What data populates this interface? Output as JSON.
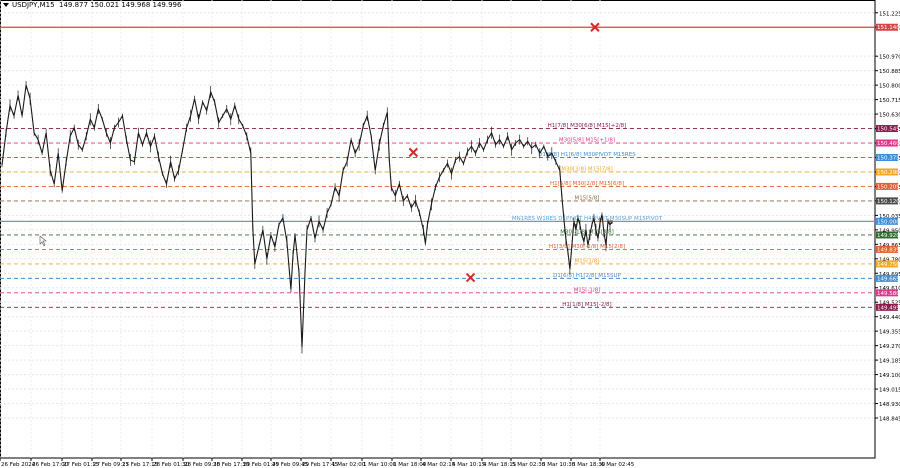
{
  "header": {
    "symbol": "USDJPY,M15",
    "ohlc": "149.877 150.021 149.968 149.996"
  },
  "chart_data": {
    "type": "line",
    "title": "USDJPY,M15",
    "ylim": [
      148.61,
      151.3
    ],
    "y_ticks": [
      "151.225",
      "151.140",
      "150.970",
      "150.885",
      "150.800",
      "150.715",
      "150.630",
      "150.545",
      "150.460",
      "150.375",
      "150.290",
      "150.205",
      "150.120",
      "150.035",
      "149.950",
      "149.865",
      "149.780",
      "149.695",
      "149.610",
      "149.525",
      "149.440",
      "149.355",
      "149.270",
      "149.185",
      "149.100",
      "149.015",
      "148.930",
      "148.845"
    ],
    "x_ticks": [
      "26 Feb 2024",
      "26 Feb 17:00",
      "27 Feb 01:15",
      "27 Feb 09:15",
      "27 Feb 17:15",
      "28 Feb 01:30",
      "28 Feb 09:30",
      "28 Feb 17:30",
      "29 Feb 01:45",
      "29 Feb 09:45",
      "29 Feb 17:45",
      "1 Mar 02:00",
      "1 Mar 10:00",
      "1 Mar 18:00",
      "4 Mar 02:15",
      "4 Mar 10:15",
      "4 Mar 18:15",
      "5 Mar 02:30",
      "5 Mar 10:30",
      "5 Mar 18:30",
      "6 Mar 02:45"
    ],
    "current_price": "150.000",
    "price_series": [
      {
        "i": 0,
        "y": 150.33
      },
      {
        "i": 4,
        "y": 150.52
      },
      {
        "i": 8,
        "y": 150.68
      },
      {
        "i": 12,
        "y": 150.62
      },
      {
        "i": 16,
        "y": 150.74
      },
      {
        "i": 20,
        "y": 150.62
      },
      {
        "i": 24,
        "y": 150.8
      },
      {
        "i": 28,
        "y": 150.72
      },
      {
        "i": 32,
        "y": 150.52
      },
      {
        "i": 36,
        "y": 150.48
      },
      {
        "i": 40,
        "y": 150.4
      },
      {
        "i": 44,
        "y": 150.52
      },
      {
        "i": 48,
        "y": 150.3
      },
      {
        "i": 52,
        "y": 150.22
      },
      {
        "i": 56,
        "y": 150.4
      },
      {
        "i": 60,
        "y": 150.18
      },
      {
        "i": 64,
        "y": 150.35
      },
      {
        "i": 68,
        "y": 150.5
      },
      {
        "i": 72,
        "y": 150.55
      },
      {
        "i": 76,
        "y": 150.45
      },
      {
        "i": 80,
        "y": 150.42
      },
      {
        "i": 84,
        "y": 150.5
      },
      {
        "i": 88,
        "y": 150.6
      },
      {
        "i": 92,
        "y": 150.55
      },
      {
        "i": 96,
        "y": 150.66
      },
      {
        "i": 100,
        "y": 150.6
      },
      {
        "i": 104,
        "y": 150.52
      },
      {
        "i": 108,
        "y": 150.46
      },
      {
        "i": 112,
        "y": 150.55
      },
      {
        "i": 116,
        "y": 150.58
      },
      {
        "i": 120,
        "y": 150.62
      },
      {
        "i": 124,
        "y": 150.48
      },
      {
        "i": 128,
        "y": 150.36
      },
      {
        "i": 132,
        "y": 150.35
      },
      {
        "i": 136,
        "y": 150.52
      },
      {
        "i": 140,
        "y": 150.45
      },
      {
        "i": 144,
        "y": 150.52
      },
      {
        "i": 148,
        "y": 150.44
      },
      {
        "i": 152,
        "y": 150.5
      },
      {
        "i": 156,
        "y": 150.38
      },
      {
        "i": 160,
        "y": 150.28
      },
      {
        "i": 164,
        "y": 150.22
      },
      {
        "i": 168,
        "y": 150.35
      },
      {
        "i": 172,
        "y": 150.25
      },
      {
        "i": 176,
        "y": 150.3
      },
      {
        "i": 180,
        "y": 150.42
      },
      {
        "i": 184,
        "y": 150.55
      },
      {
        "i": 188,
        "y": 150.62
      },
      {
        "i": 192,
        "y": 150.72
      },
      {
        "i": 196,
        "y": 150.6
      },
      {
        "i": 200,
        "y": 150.7
      },
      {
        "i": 204,
        "y": 150.65
      },
      {
        "i": 208,
        "y": 150.76
      },
      {
        "i": 212,
        "y": 150.7
      },
      {
        "i": 216,
        "y": 150.58
      },
      {
        "i": 220,
        "y": 150.62
      },
      {
        "i": 224,
        "y": 150.66
      },
      {
        "i": 228,
        "y": 150.6
      },
      {
        "i": 232,
        "y": 150.68
      },
      {
        "i": 236,
        "y": 150.6
      },
      {
        "i": 240,
        "y": 150.56
      },
      {
        "i": 244,
        "y": 150.5
      },
      {
        "i": 248,
        "y": 150.4
      },
      {
        "i": 250,
        "y": 149.96
      },
      {
        "i": 252,
        "y": 149.75
      },
      {
        "i": 256,
        "y": 149.85
      },
      {
        "i": 260,
        "y": 149.95
      },
      {
        "i": 264,
        "y": 149.78
      },
      {
        "i": 268,
        "y": 149.92
      },
      {
        "i": 272,
        "y": 149.85
      },
      {
        "i": 276,
        "y": 149.98
      },
      {
        "i": 280,
        "y": 150.02
      },
      {
        "i": 284,
        "y": 149.88
      },
      {
        "i": 288,
        "y": 149.6
      },
      {
        "i": 290,
        "y": 149.8
      },
      {
        "i": 292,
        "y": 149.92
      },
      {
        "i": 296,
        "y": 149.7
      },
      {
        "i": 299,
        "y": 149.26
      },
      {
        "i": 302,
        "y": 149.7
      },
      {
        "i": 304,
        "y": 149.95
      },
      {
        "i": 308,
        "y": 150.02
      },
      {
        "i": 312,
        "y": 149.9
      },
      {
        "i": 316,
        "y": 150.0
      },
      {
        "i": 320,
        "y": 149.95
      },
      {
        "i": 324,
        "y": 150.05
      },
      {
        "i": 328,
        "y": 150.1
      },
      {
        "i": 332,
        "y": 150.2
      },
      {
        "i": 336,
        "y": 150.15
      },
      {
        "i": 340,
        "y": 150.3
      },
      {
        "i": 344,
        "y": 150.35
      },
      {
        "i": 348,
        "y": 150.48
      },
      {
        "i": 352,
        "y": 150.4
      },
      {
        "i": 356,
        "y": 150.45
      },
      {
        "i": 360,
        "y": 150.56
      },
      {
        "i": 364,
        "y": 150.62
      },
      {
        "i": 368,
        "y": 150.5
      },
      {
        "i": 372,
        "y": 150.3
      },
      {
        "i": 376,
        "y": 150.45
      },
      {
        "i": 380,
        "y": 150.56
      },
      {
        "i": 384,
        "y": 150.64
      },
      {
        "i": 386,
        "y": 150.36
      },
      {
        "i": 388,
        "y": 150.2
      },
      {
        "i": 392,
        "y": 150.15
      },
      {
        "i": 396,
        "y": 150.22
      },
      {
        "i": 400,
        "y": 150.12
      },
      {
        "i": 404,
        "y": 150.15
      },
      {
        "i": 408,
        "y": 150.08
      },
      {
        "i": 412,
        "y": 150.12
      },
      {
        "i": 416,
        "y": 150.05
      },
      {
        "i": 420,
        "y": 149.95
      },
      {
        "i": 422,
        "y": 149.87
      },
      {
        "i": 424,
        "y": 149.98
      },
      {
        "i": 428,
        "y": 150.1
      },
      {
        "i": 432,
        "y": 150.2
      },
      {
        "i": 436,
        "y": 150.26
      },
      {
        "i": 440,
        "y": 150.3
      },
      {
        "i": 444,
        "y": 150.34
      },
      {
        "i": 448,
        "y": 150.28
      },
      {
        "i": 452,
        "y": 150.36
      },
      {
        "i": 456,
        "y": 150.38
      },
      {
        "i": 460,
        "y": 150.34
      },
      {
        "i": 464,
        "y": 150.41
      },
      {
        "i": 468,
        "y": 150.44
      },
      {
        "i": 472,
        "y": 150.4
      },
      {
        "i": 476,
        "y": 150.46
      },
      {
        "i": 480,
        "y": 150.42
      },
      {
        "i": 484,
        "y": 150.48
      },
      {
        "i": 488,
        "y": 150.52
      },
      {
        "i": 492,
        "y": 150.45
      },
      {
        "i": 496,
        "y": 150.48
      },
      {
        "i": 500,
        "y": 150.44
      },
      {
        "i": 504,
        "y": 150.5
      },
      {
        "i": 508,
        "y": 150.42
      },
      {
        "i": 512,
        "y": 150.46
      },
      {
        "i": 516,
        "y": 150.48
      },
      {
        "i": 520,
        "y": 150.44
      },
      {
        "i": 524,
        "y": 150.47
      },
      {
        "i": 528,
        "y": 150.43
      },
      {
        "i": 532,
        "y": 150.45
      },
      {
        "i": 536,
        "y": 150.4
      },
      {
        "i": 540,
        "y": 150.44
      },
      {
        "i": 544,
        "y": 150.38
      },
      {
        "i": 548,
        "y": 150.4
      },
      {
        "i": 552,
        "y": 150.35
      },
      {
        "i": 556,
        "y": 150.3
      },
      {
        "i": 558,
        "y": 150.15
      },
      {
        "i": 560,
        "y": 150.02
      },
      {
        "i": 562,
        "y": 149.9
      },
      {
        "i": 564,
        "y": 149.82
      },
      {
        "i": 566,
        "y": 149.72
      },
      {
        "i": 568,
        "y": 149.86
      },
      {
        "i": 570,
        "y": 150.0
      },
      {
        "i": 572,
        "y": 149.95
      },
      {
        "i": 574,
        "y": 150.02
      },
      {
        "i": 576,
        "y": 149.98
      },
      {
        "i": 578,
        "y": 149.92
      },
      {
        "i": 580,
        "y": 149.88
      },
      {
        "i": 582,
        "y": 149.95
      },
      {
        "i": 584,
        "y": 149.86
      },
      {
        "i": 586,
        "y": 149.92
      },
      {
        "i": 588,
        "y": 149.98
      },
      {
        "i": 590,
        "y": 150.02
      },
      {
        "i": 592,
        "y": 149.95
      },
      {
        "i": 594,
        "y": 149.9
      },
      {
        "i": 596,
        "y": 149.99
      },
      {
        "i": 598,
        "y": 150.04
      },
      {
        "i": 600,
        "y": 149.93
      },
      {
        "i": 602,
        "y": 149.86
      },
      {
        "i": 604,
        "y": 150.0
      },
      {
        "i": 606,
        "y": 149.98
      },
      {
        "i": 608,
        "y": 149.996
      }
    ],
    "levels": [
      {
        "label": "",
        "price": 151.14,
        "color": "#d64545",
        "style": "solid",
        "tag": "151.140",
        "tagbg": "#d64545"
      },
      {
        "label": "H1[7/8] M30[6/8] M15[+2/8]",
        "price": 150.545,
        "color": "#8b1a4a",
        "style": "dash",
        "tag": "150.545",
        "tagbg": "#8b1a4a"
      },
      {
        "label": "M30[5/8] M15[+1/8]",
        "price": 150.46,
        "color": "#e0358a",
        "style": "dash",
        "tag": "150.460",
        "tagbg": "#e0358a"
      },
      {
        "label": "D1[8/8] H1[6/8] M30PIVOT M15RES",
        "price": 150.375,
        "color": "#3a8fd8",
        "style": "dash",
        "tag": "150.375",
        "tagbg": "#3a8fd8"
      },
      {
        "label": "M30[3/8] M15[7/8]",
        "price": 150.29,
        "color": "#f5a623",
        "style": "dash",
        "tag": "150.290",
        "tagbg": "#f5a623"
      },
      {
        "label": "H1[5/8] M30[2/8] M15[6/8]",
        "price": 150.205,
        "color": "#e06030",
        "style": "dash",
        "tag": "150.205",
        "tagbg": "#e06030"
      },
      {
        "label": "M15[5/8]",
        "price": 150.12,
        "color": "#8b6b3a",
        "style": "dash",
        "tag": "150.120",
        "tagbg": "#4a4a4a"
      },
      {
        "label": "MN1RES W1RES D1PIVOT H4PIVOT M30SUP M15PIVOT",
        "price": 150.0,
        "color": "#5a9fd6",
        "style": "solid",
        "tag": "150.000",
        "tagbg": "#3a8fd8"
      },
      {
        "label": "M30[-1/8] M15[3/8]",
        "price": 149.92,
        "color": "#2f6b2f",
        "style": "dash",
        "tag": "149.920",
        "tagbg": "#2f6b2f"
      },
      {
        "label": "H1[3/8] M30[-2/8] M15[2/8]",
        "price": 149.835,
        "color": "#e06030",
        "style": "dash",
        "tag": "149.835",
        "tagbg": "#e06030"
      },
      {
        "label": "M15[1/8]",
        "price": 149.75,
        "color": "#f5a623",
        "style": "dash",
        "tag": "149.750",
        "tagbg": "#f5a623"
      },
      {
        "label": "D1[6/8] H1[2/8] M15SUP",
        "price": 149.665,
        "color": "#3a8fd8",
        "style": "dash",
        "tag": "149.665",
        "tagbg": "#3a8fd8"
      },
      {
        "label": "M15[-1/8]",
        "price": 149.58,
        "color": "#e0358a",
        "style": "dash",
        "tag": "149.580",
        "tagbg": "#e0358a"
      },
      {
        "label": "H1[1/8] M15[-2/8]",
        "price": 149.495,
        "color": "#8b1a4a",
        "style": "dash",
        "tag": "149.495",
        "tagbg": "#8b1a4a"
      }
    ],
    "markers": [
      {
        "x_index": 591,
        "price": 151.14,
        "symbol": "x",
        "color": "#d62828"
      },
      {
        "x_index": 410,
        "price": 150.405,
        "symbol": "x",
        "color": "#d62828"
      },
      {
        "x_index": 467,
        "price": 149.67,
        "symbol": "x",
        "color": "#d62828"
      }
    ],
    "grid": true
  }
}
